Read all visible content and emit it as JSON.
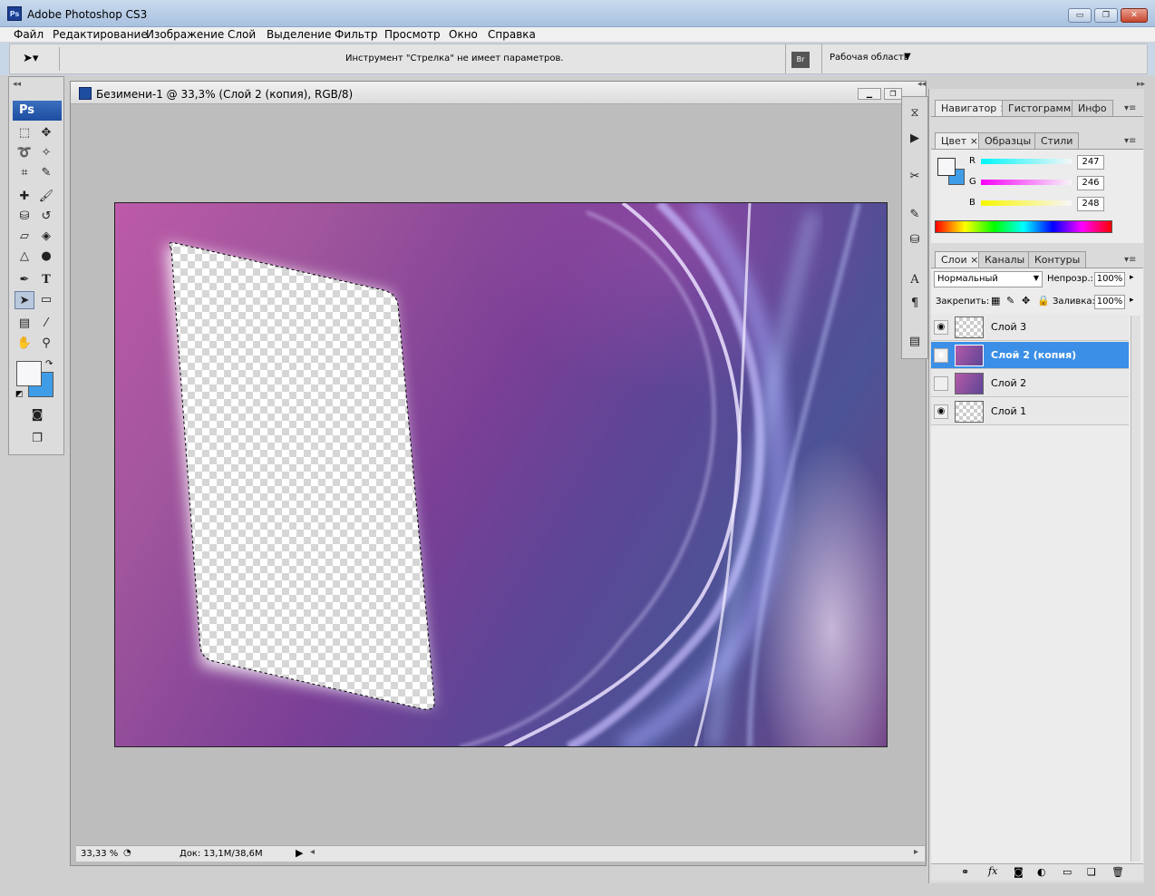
{
  "window": {
    "app_icon": "Ps",
    "title": "Adobe Photoshop CS3",
    "minimize": "▭",
    "maximize": "❐",
    "close": "✕"
  },
  "menu": [
    "Файл",
    "Редактирование",
    "Изображение",
    "Слой",
    "Выделение",
    "Фильтр",
    "Просмотр",
    "Окно",
    "Справка"
  ],
  "options_bar": {
    "text": "Инструмент \"Стрелка\" не имеет параметров.",
    "workspace_label": "Рабочая область",
    "workspace_arrow": "▼"
  },
  "toolbox": {
    "logo": "Ps"
  },
  "document": {
    "title": "Безимени-1 @ 33,3% (Слой 2 (копия), RGB/8)",
    "zoom": "33,33 %",
    "doc_info": "Док: 13,1M/38,6M"
  },
  "panels": {
    "navigator_tabs": [
      "Навигатор",
      "Гистограмма",
      "Инфо"
    ],
    "color_tabs": [
      "Цвет",
      "Образцы",
      "Стили"
    ],
    "color": {
      "r_label": "R",
      "g_label": "G",
      "b_label": "B",
      "r": "247",
      "g": "246",
      "b": "248"
    },
    "layers_tabs": [
      "Слои",
      "Каналы",
      "Контуры"
    ],
    "blend_mode": "Нормальный",
    "opacity_label": "Непрозр.:",
    "opacity": "100%",
    "lock_label": "Закрепить:",
    "fill_label": "Заливка:",
    "fill": "100%",
    "layers": [
      {
        "name": "Слой 3",
        "visible": true,
        "selected": false
      },
      {
        "name": "Слой 2 (копия)",
        "visible": true,
        "selected": true
      },
      {
        "name": "Слой 2",
        "visible": false,
        "selected": false
      },
      {
        "name": "Слой 1",
        "visible": true,
        "selected": false
      }
    ]
  },
  "colors": {
    "accent": "#3b8fe6",
    "fg_color": "#f7f6f8",
    "bg_color": "#3f9de8"
  }
}
